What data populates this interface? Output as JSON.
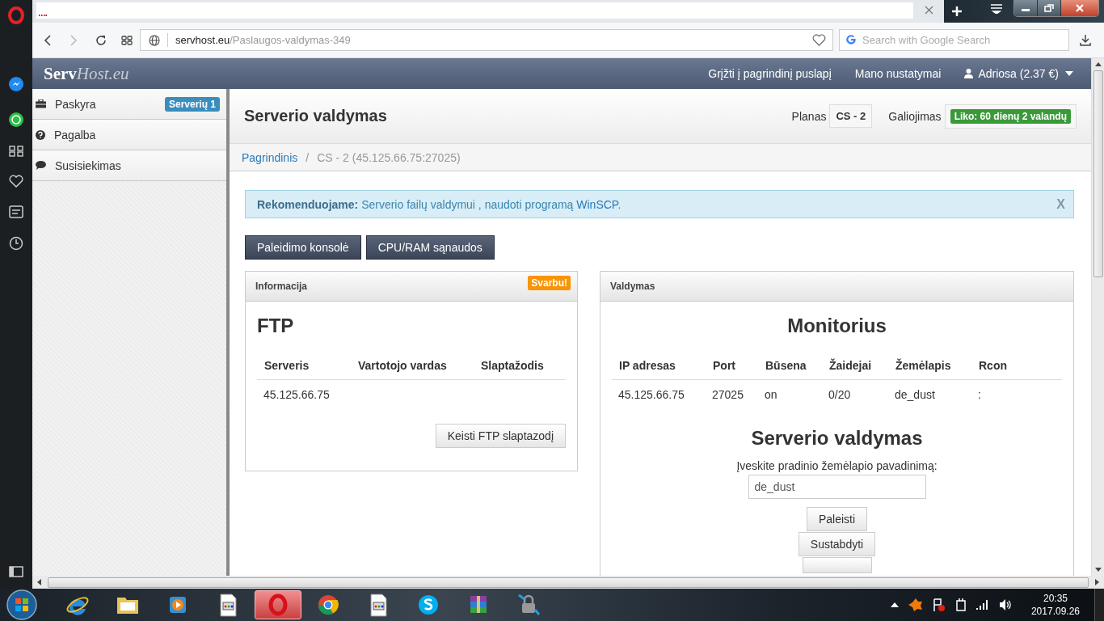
{
  "browser": {
    "url_host": "servhost.eu",
    "url_path": "/Paslaugos-valdymas-349",
    "search_placeholder": "Search with Google Search"
  },
  "site_header": {
    "logo_main": "Serv",
    "logo_suffix": "Host.eu",
    "nav": [
      "Grįžti į pagrindinį puslapį",
      "Mano nustatymai"
    ],
    "user": "Adriosa (2.37 €)"
  },
  "sidebar": {
    "items": [
      {
        "kind": "briefcase",
        "label": "Paskyra",
        "badge": "Serverių 1"
      },
      {
        "kind": "question",
        "label": "Pagalba"
      },
      {
        "kind": "comment",
        "label": "Susisiekimas"
      }
    ]
  },
  "page": {
    "title": "Serverio valdymas",
    "plan_label": "Planas",
    "plan": "CS - 2",
    "validity_label": "Galiojimas",
    "validity": "Liko: 60 dienų 2 valandų"
  },
  "breadcrumb_separator": "/",
  "breadcrumb": [
    {
      "label": "Pagrindinis",
      "link": true
    },
    {
      "label": "CS - 2 (45.125.66.75:27025)",
      "link": false
    }
  ],
  "alert": {
    "lead": "Rekomenduojame:",
    "text": "Serverio failų valdymui , naudoti programą",
    "link": "WinSCP",
    "tail": ".",
    "close": "X"
  },
  "action_buttons": [
    "Paleidimo konsolė",
    "CPU/RAM sąnaudos"
  ],
  "info_panel": {
    "title": "Informacija",
    "badge": "Svarbu!",
    "heading": "FTP",
    "columns": [
      "Serveris",
      "Vartotojo vardas",
      "Slaptažodis"
    ],
    "rows": [
      [
        "45.125.66.75",
        "",
        ""
      ]
    ],
    "button": "Keisti FTP slaptazodį"
  },
  "control_panel": {
    "title": "Valdymas",
    "heading": "Monitorius",
    "columns": [
      "IP adresas",
      "Port",
      "Būsena",
      "Žaidejai",
      "Žemėlapis",
      "Rcon"
    ],
    "rows": [
      [
        "45.125.66.75",
        "27025",
        "on",
        "0/20",
        "de_dust",
        ":"
      ]
    ],
    "heading2": "Serverio valdymas",
    "field_label": "Įveskite pradinio žemėlapio pavadinimą:",
    "field_value": "de_dust",
    "buttons": [
      "Paleisti",
      "Sustabdyti"
    ]
  },
  "taskbar": {
    "apps": [
      {
        "kind": "ie",
        "selected": false
      },
      {
        "kind": "folder",
        "selected": false
      },
      {
        "kind": "media",
        "selected": false
      },
      {
        "kind": "doc",
        "selected": false
      },
      {
        "kind": "opera",
        "selected": true
      },
      {
        "kind": "chrome",
        "selected": false
      },
      {
        "kind": "doc",
        "selected": false
      },
      {
        "kind": "skype",
        "selected": false
      },
      {
        "kind": "archive",
        "selected": false
      },
      {
        "kind": "lock",
        "selected": false
      }
    ],
    "time": "20:35",
    "date": "2017.09.26"
  }
}
